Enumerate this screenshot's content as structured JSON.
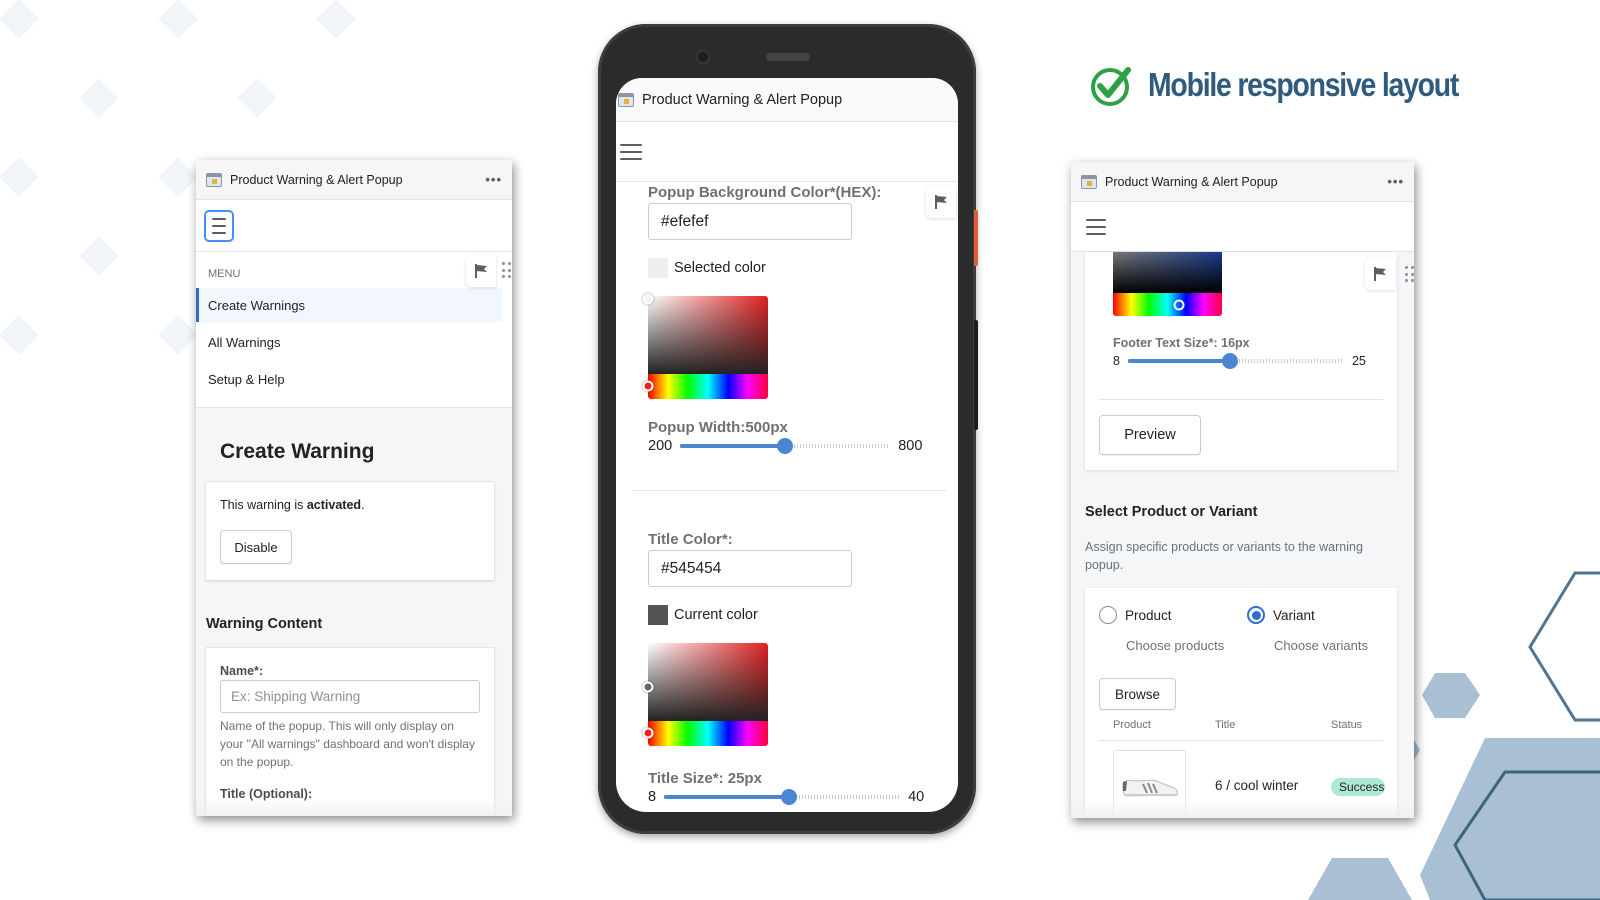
{
  "headline": {
    "text": "Mobile responsive layout",
    "icon": "check-circle-icon",
    "icon_color": "#2ea043",
    "text_color": "#2f5b7f"
  },
  "app": {
    "title": "Product Warning & Alert Popup",
    "more_icon": "more-horizontal-icon",
    "menu_icon": "hamburger-icon",
    "flag_icon": "flag-icon",
    "grip_icon": "drag-handle-icon"
  },
  "left_screen": {
    "menu_label": "MENU",
    "menu_items": [
      {
        "label": "Create Warnings",
        "active": true
      },
      {
        "label": "All Warnings",
        "active": false
      },
      {
        "label": "Setup & Help",
        "active": false
      }
    ],
    "page_title": "Create Warning",
    "status": {
      "prefix": "This warning is ",
      "state": "activated",
      "suffix": "."
    },
    "disable_button": "Disable",
    "section_heading": "Warning Content",
    "name_field": {
      "label": "Name*:",
      "placeholder": "Ex: Shipping Warning",
      "value": "",
      "help": "Name of the popup. This will only display on your \"All warnings\" dashboard and won't display on the popup."
    },
    "title_field_label": "Title (Optional):"
  },
  "phone_screen": {
    "bg_color": {
      "label": "Popup Background Color*(HEX):",
      "value": "#efefef",
      "swatch_label": "Selected color",
      "swatch_color": "#efefef"
    },
    "popup_width": {
      "label": "Popup Width:500px",
      "min": 200,
      "max": 800,
      "value": 500
    },
    "title_color": {
      "label": "Title Color*:",
      "value": "#545454",
      "swatch_label": "Current color",
      "swatch_color": "#545454"
    },
    "title_size": {
      "label": "Title Size*: 25px",
      "min": 8,
      "max": 40,
      "value": 25
    }
  },
  "right_screen": {
    "footer_text_size": {
      "label": "Footer Text Size*: 16px",
      "min": 8,
      "max": 25,
      "value": 16
    },
    "preview_button": "Preview",
    "select_section": {
      "title": "Select Product or Variant",
      "description": "Assign specific products or variants to the warning popup."
    },
    "radio_options": [
      {
        "label": "Product",
        "sub": "Choose products",
        "checked": false
      },
      {
        "label": "Variant",
        "sub": "Choose variants",
        "checked": true
      }
    ],
    "browse_button": "Browse",
    "table": {
      "headers": [
        "Product",
        "Title",
        "Status"
      ],
      "rows": [
        {
          "product_image": "sneaker-image",
          "title": "6 / cool winter",
          "status": "Success"
        }
      ]
    },
    "status_color": "#aee9d1"
  }
}
